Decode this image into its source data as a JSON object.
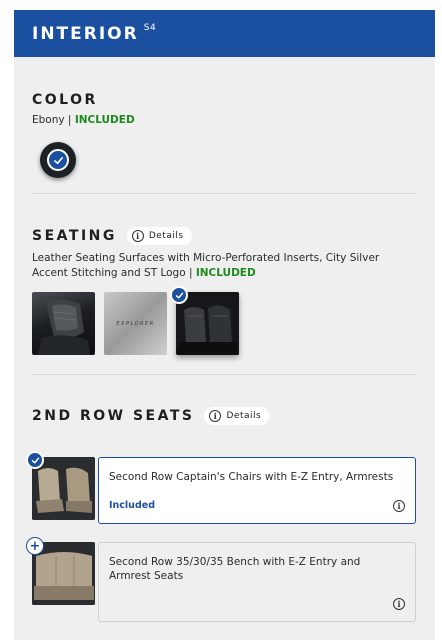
{
  "header": {
    "title": "INTERIOR",
    "superscript": "S4"
  },
  "color": {
    "title": "COLOR",
    "selected_name": "Ebony",
    "separator": " | ",
    "status": "INCLUDED",
    "swatch_color": "#1d2124",
    "swatch_selected": true
  },
  "seating": {
    "title": "SEATING",
    "details_label": "Details",
    "description": "Leather Seating Surfaces with Micro-Perforated Inserts, City Silver Accent Stitching and ST Logo",
    "separator": " | ",
    "status": "INCLUDED",
    "thumbnails": [
      {
        "label": "",
        "selected": false
      },
      {
        "label": "EXPLORER",
        "selected": false
      },
      {
        "label": "",
        "selected": true
      }
    ]
  },
  "second_row": {
    "title": "2ND ROW SEATS",
    "details_label": "Details",
    "options": [
      {
        "name": "Second Row Captain's Chairs with E-Z Entry, Armrests",
        "status": "Included",
        "selected": true,
        "icon": "check-icon"
      },
      {
        "name": "Second Row 35/30/35 Bench with E-Z Entry and Armrest Seats",
        "status": "",
        "selected": false,
        "icon": "plus-icon"
      }
    ]
  },
  "colors": {
    "brand_blue": "#1b4fa0",
    "included_green": "#1e8a1e",
    "panel_bg": "#efefef"
  }
}
